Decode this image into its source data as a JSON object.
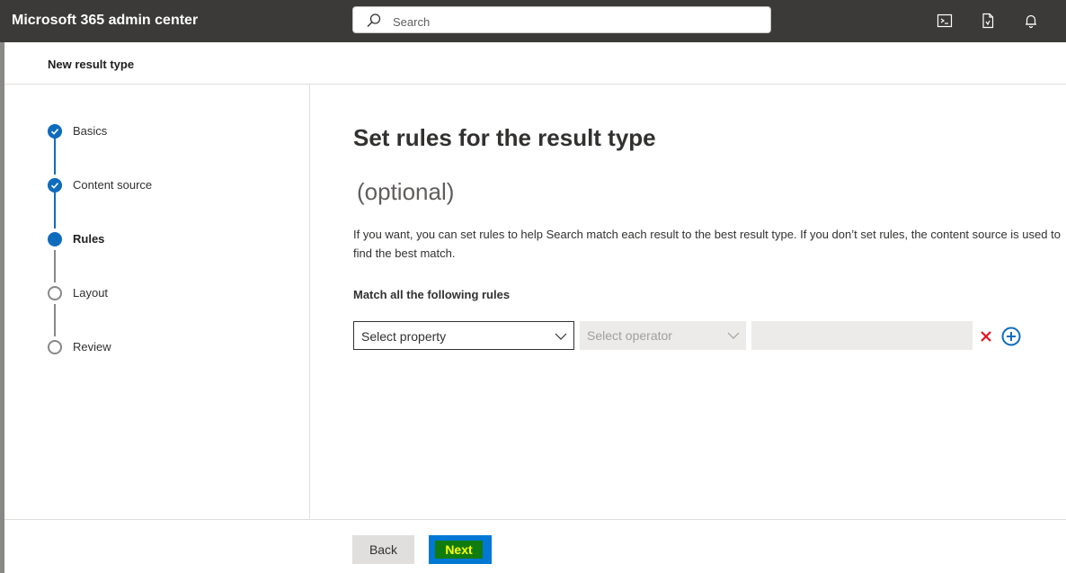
{
  "header": {
    "app_title": "Microsoft 365 admin center",
    "search_placeholder": "Search",
    "icons": [
      "terminal-icon",
      "document-icon",
      "bell-icon"
    ]
  },
  "panel": {
    "title": "New result type"
  },
  "steps": [
    {
      "label": "Basics",
      "state": "complete"
    },
    {
      "label": "Content source",
      "state": "complete"
    },
    {
      "label": "Rules",
      "state": "current"
    },
    {
      "label": "Layout",
      "state": "pending"
    },
    {
      "label": "Review",
      "state": "pending"
    }
  ],
  "main": {
    "heading": "Set rules for the result type",
    "optional": "(optional)",
    "description": "If you want, you can set rules to help Search match each result to the best result type. If you don’t set rules, the content source is used to find the best match.",
    "rules_label": "Match all the following rules",
    "rule": {
      "property_placeholder": "Select property",
      "operator_placeholder": "Select operator",
      "value": ""
    }
  },
  "footer": {
    "back_label": "Back",
    "next_label": "Next"
  },
  "colors": {
    "topbar": "#3b3a39",
    "accent": "#0f6cbd",
    "delete": "#e81123",
    "next_button": "#0078d4",
    "next_highlight": "#107c10",
    "next_text": "#ffff00"
  }
}
